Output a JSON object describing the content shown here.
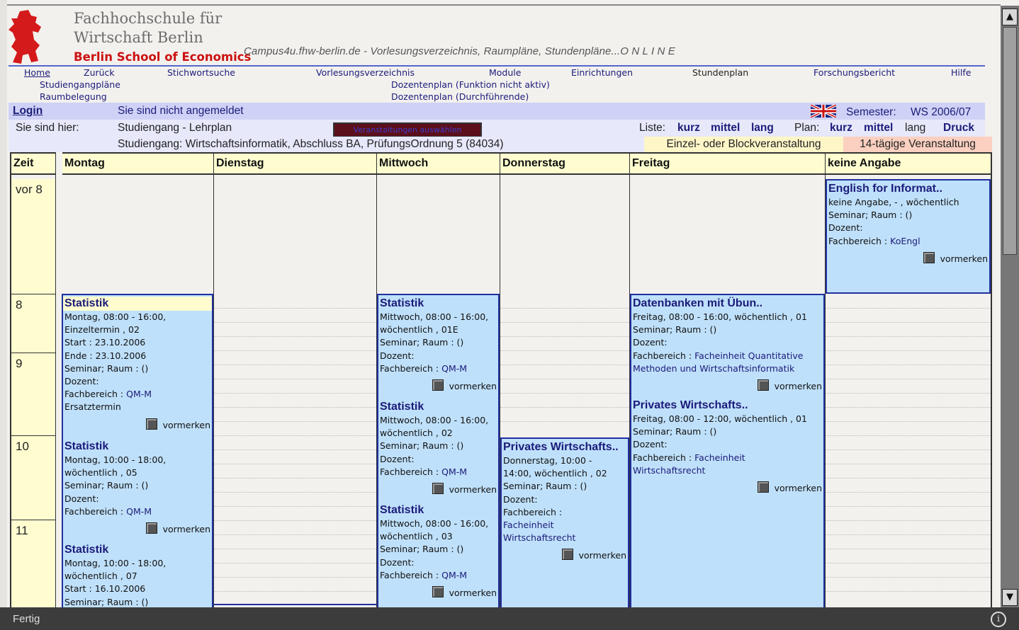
{
  "header": {
    "institution_line1": "Fachhochschule für",
    "institution_line2": "Wirtschaft Berlin",
    "institution_line3": "Berlin School of Economics",
    "tagline": "Campus4u.fhw-berlin.de - Vorlesungsverzeichnis, Raumpläne, Stundenpläne...O N L I N E"
  },
  "nav": {
    "items": [
      "Home",
      "Zurück",
      "Stichwortsuche",
      "Vorlesungsverzeichnis",
      "Module",
      "Einrichtungen",
      "Stundenplan",
      "Forschungsbericht",
      "Hilfe"
    ],
    "sub_left": [
      "Studiengangpläne",
      "Raumbelegung"
    ],
    "sub_center": [
      "Dozentenplan (Funktion nicht aktiv)",
      "Dozentenplan (Durchführende)"
    ]
  },
  "info": {
    "login": "Login",
    "login_status": "Sie sind nicht angemeldet",
    "semester_label": "Semester:",
    "semester_value": "WS 2006/07",
    "breadcrumb_label": "Sie sind hier:",
    "breadcrumb_value": "Studiengang - Lehrplan",
    "ndays_button": "Veranstaltungen auswählen",
    "liste_label": "Liste:",
    "liste_options": [
      "kurz",
      "mittel",
      "lang"
    ],
    "plan_label": "Plan:",
    "plan_options": [
      "kurz",
      "mittel",
      "lang"
    ],
    "druck": "Druck",
    "studiengang": "Studiengang:  Wirtschaftsinformatik, Abschluss BA, PrüfungsOrdnung 5 (84034)",
    "legend_single": "Einzel- oder Blockveranstaltung",
    "legend_biweekly": "14-tägige Veranstaltung"
  },
  "timetable": {
    "columns": [
      "Zeit",
      "Montag",
      "Dienstag",
      "Mittwoch",
      "Donnerstag",
      "Freitag",
      "keine Angabe"
    ],
    "times": [
      "vor 8",
      "8",
      "9",
      "10",
      "11"
    ],
    "vormerken": "vormerken",
    "events": {
      "mo1": {
        "title": "Statistik",
        "lines": [
          "Montag,  08:00 - 16:00,",
          "Einzeltermin , 02",
          "Start :  23.10.2006",
          "Ende :  23.10.2006",
          "Seminar; Raum :  ()",
          "Dozent:"
        ],
        "fb_label": "Fachbereich :",
        "fb_value": "QM-M",
        "extra": "Ersatztermin"
      },
      "mo2": {
        "title": "Statistik",
        "lines": [
          "Montag,  10:00 - 18:00,",
          "wöchentlich , 05",
          "Seminar; Raum :  ()",
          "Dozent:"
        ],
        "fb_label": "Fachbereich :",
        "fb_value": "QM-M"
      },
      "mo3": {
        "title": "Statistik",
        "lines": [
          "Montag,  10:00 - 18:00,",
          "wöchentlich , 07",
          "Start :  16.10.2006",
          "Seminar; Raum :  ()"
        ]
      },
      "mi1": {
        "title": "Statistik",
        "lines": [
          "Mittwoch,  08:00 - 16:00,",
          "wöchentlich , 01E",
          "Seminar; Raum :  ()",
          "Dozent:"
        ],
        "fb_label": "Fachbereich :",
        "fb_value": "QM-M"
      },
      "mi2": {
        "title": "Statistik",
        "lines": [
          "Mittwoch,  08:00 - 16:00,",
          "wöchentlich , 02",
          "Seminar; Raum :  ()",
          "Dozent:"
        ],
        "fb_label": "Fachbereich :",
        "fb_value": "QM-M"
      },
      "mi3": {
        "title": "Statistik",
        "lines": [
          "Mittwoch,  08:00 - 16:00,",
          "wöchentlich , 03",
          "Seminar; Raum :  ()",
          "Dozent:"
        ],
        "fb_label": "Fachbereich :",
        "fb_value": "QM-M"
      },
      "do1": {
        "title": "Privates Wirtschafts..",
        "lines": [
          "Donnerstag,  10:00 -",
          "14:00, wöchentlich , 02",
          "Seminar; Raum :  ()",
          "Dozent:",
          "Fachbereich :"
        ],
        "fb_value1": "Facheinheit",
        "fb_value2": "Wirtschaftsrecht"
      },
      "fr1": {
        "title": "Datenbanken mit Übun..",
        "lines": [
          "Freitag,  08:00 - 16:00, wöchentlich , 01",
          "Seminar; Raum :  ()",
          "Dozent:"
        ],
        "fb_label": "Fachbereich :",
        "fb_value1": "Facheinheit Quantitative",
        "fb_value2": "Methoden und Wirtschaftsinformatik"
      },
      "fr2": {
        "title": "Privates Wirtschafts..",
        "lines": [
          "Freitag,  08:00 - 12:00, wöchentlich , 01",
          "Seminar; Raum :  ()",
          "Dozent:"
        ],
        "fb_label": "Fachbereich :",
        "fb_value1": "Facheinheit",
        "fb_value2": "Wirtschaftsrecht"
      },
      "ka1": {
        "title": "English for Informat..",
        "lines": [
          "keine Angabe,  - , wöchentlich",
          "Seminar; Raum :  ()",
          "Dozent:"
        ],
        "fb_label": "Fachbereich :",
        "fb_value": "KoEngl"
      }
    }
  },
  "status_bar": {
    "text": "Fertig"
  },
  "colors": {
    "event_bg": "#bfe0fa",
    "event_border": "#2030a0",
    "header_yellow": "#fffdd0",
    "legend_biweekly": "#fbd0c0",
    "brand_red": "#cc1111"
  }
}
